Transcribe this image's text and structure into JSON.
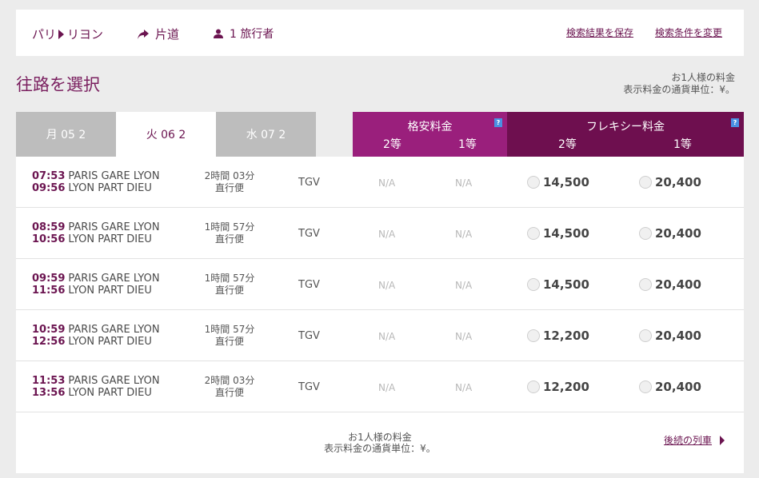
{
  "header": {
    "origin": "パリ",
    "destination": "リヨン",
    "trip_type": "片道",
    "travelers": "1 旅行者",
    "save_link": "検索結果を保存",
    "change_link": "検索条件を変更"
  },
  "page_title": "往路を選択",
  "fare_info": {
    "line1": "お1人様の料金",
    "line2": "表示料金の通貨単位：¥。"
  },
  "date_tabs": [
    {
      "label": "月 05 2",
      "active": false
    },
    {
      "label": "火 06 2",
      "active": true
    },
    {
      "label": "水 07 2",
      "active": false
    }
  ],
  "fare_columns": {
    "budget": {
      "title": "格安料金",
      "class2": "2等",
      "class1": "1等",
      "help": "?"
    },
    "flexi": {
      "title": "フレキシー料金",
      "class2": "2等",
      "class1": "1等",
      "help": "?"
    }
  },
  "trains": [
    {
      "dep_time": "07:53",
      "dep_station": "PARIS GARE LYON",
      "arr_time": "09:56",
      "arr_station": "LYON PART DIEU",
      "duration": "2時間 03分",
      "direct": "直行便",
      "type": "TGV",
      "budget2": "N/A",
      "budget1": "N/A",
      "flexi2": "14,500",
      "flexi1": "20,400"
    },
    {
      "dep_time": "08:59",
      "dep_station": "PARIS GARE LYON",
      "arr_time": "10:56",
      "arr_station": "LYON PART DIEU",
      "duration": "1時間 57分",
      "direct": "直行便",
      "type": "TGV",
      "budget2": "N/A",
      "budget1": "N/A",
      "flexi2": "14,500",
      "flexi1": "20,400"
    },
    {
      "dep_time": "09:59",
      "dep_station": "PARIS GARE LYON",
      "arr_time": "11:56",
      "arr_station": "LYON PART DIEU",
      "duration": "1時間 57分",
      "direct": "直行便",
      "type": "TGV",
      "budget2": "N/A",
      "budget1": "N/A",
      "flexi2": "14,500",
      "flexi1": "20,400"
    },
    {
      "dep_time": "10:59",
      "dep_station": "PARIS GARE LYON",
      "arr_time": "12:56",
      "arr_station": "LYON PART DIEU",
      "duration": "1時間 57分",
      "direct": "直行便",
      "type": "TGV",
      "budget2": "N/A",
      "budget1": "N/A",
      "flexi2": "12,200",
      "flexi1": "20,400"
    },
    {
      "dep_time": "11:53",
      "dep_station": "PARIS GARE LYON",
      "arr_time": "13:56",
      "arr_station": "LYON PART DIEU",
      "duration": "2時間 03分",
      "direct": "直行便",
      "type": "TGV",
      "budget2": "N/A",
      "budget1": "N/A",
      "flexi2": "12,200",
      "flexi1": "20,400"
    }
  ],
  "footer": {
    "line1": "お1人様の料金",
    "line2": "表示料金の通貨単位：¥。",
    "next_link": "後続の列車"
  },
  "colors": {
    "brand": "#6b1450",
    "budget_header": "#9a1f7c",
    "flexi_header": "#6e0f4f",
    "tab_inactive": "#bdbdbd"
  }
}
